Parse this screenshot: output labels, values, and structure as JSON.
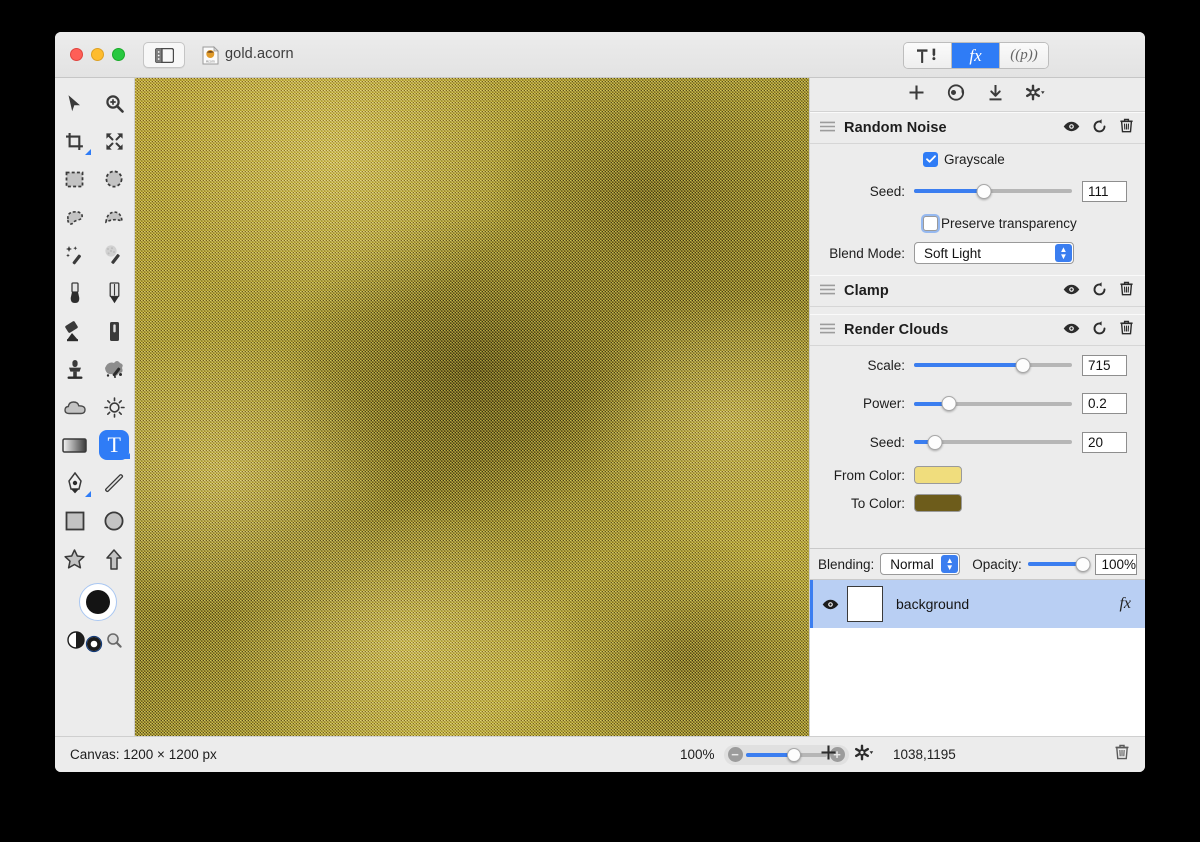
{
  "window": {
    "title": "gold.acorn",
    "doc_icon": "acorn-document-icon",
    "sidebar_toggle_icon": "sidebar-toggle-icon",
    "traffic_lights": [
      "close",
      "minimize",
      "zoom"
    ]
  },
  "segmented": {
    "items": [
      {
        "key": "tools",
        "icon": "hammer-pen-icon",
        "label": "",
        "active": false
      },
      {
        "key": "filters",
        "icon": "fx-icon",
        "label": "fx",
        "active": true
      },
      {
        "key": "presets",
        "icon": "preset-icon",
        "label": "((p))",
        "active": false
      }
    ]
  },
  "tools": {
    "items": [
      {
        "name": "move-tool",
        "icon": "arrow-cursor-icon",
        "selected": false,
        "submenu": false
      },
      {
        "name": "zoom-tool",
        "icon": "magnifier-plus-icon",
        "selected": false,
        "submenu": false
      },
      {
        "name": "crop-tool",
        "icon": "crop-icon",
        "selected": false,
        "submenu": true
      },
      {
        "name": "transform-tool",
        "icon": "four-arrows-icon",
        "selected": false,
        "submenu": false
      },
      {
        "name": "rectangular-select-tool",
        "icon": "marquee-rect-icon",
        "selected": false,
        "submenu": false
      },
      {
        "name": "elliptical-select-tool",
        "icon": "marquee-ellipse-icon",
        "selected": false,
        "submenu": false
      },
      {
        "name": "lasso-tool",
        "icon": "lasso-icon",
        "selected": false,
        "submenu": false
      },
      {
        "name": "polygon-lasso-tool",
        "icon": "polygon-lasso-icon",
        "selected": false,
        "submenu": false
      },
      {
        "name": "magic-wand-tool",
        "icon": "magic-wand-icon",
        "selected": false,
        "submenu": false
      },
      {
        "name": "instant-alpha-tool",
        "icon": "instant-alpha-icon",
        "selected": false,
        "submenu": false
      },
      {
        "name": "brush-tool",
        "icon": "brush-icon",
        "selected": false,
        "submenu": false
      },
      {
        "name": "pencil-tool",
        "icon": "pencil-icon",
        "selected": false,
        "submenu": false
      },
      {
        "name": "paint-bucket-tool",
        "icon": "paint-bucket-icon",
        "selected": false,
        "submenu": false
      },
      {
        "name": "eraser-tool",
        "icon": "eraser-icon",
        "selected": false,
        "submenu": false
      },
      {
        "name": "clone-stamp-tool",
        "icon": "clone-stamp-icon",
        "selected": false,
        "submenu": false
      },
      {
        "name": "smudge-tool",
        "icon": "smudge-splatter-icon",
        "selected": false,
        "submenu": false
      },
      {
        "name": "cloud-tool",
        "icon": "cloud-icon",
        "selected": false,
        "submenu": false
      },
      {
        "name": "dodge-burn-tool",
        "icon": "sun-icon",
        "selected": false,
        "submenu": false
      },
      {
        "name": "gradient-tool",
        "icon": "gradient-icon",
        "selected": false,
        "submenu": false
      },
      {
        "name": "text-tool",
        "icon": "text-T-icon",
        "selected": true,
        "submenu": true
      },
      {
        "name": "bezier-pen-tool",
        "icon": "fountain-pen-icon",
        "selected": false,
        "submenu": true
      },
      {
        "name": "line-tool",
        "icon": "line-icon",
        "selected": false,
        "submenu": false
      },
      {
        "name": "rectangle-shape-tool",
        "icon": "square-shape-icon",
        "selected": false,
        "submenu": false
      },
      {
        "name": "ellipse-shape-tool",
        "icon": "circle-shape-icon",
        "selected": false,
        "submenu": false
      },
      {
        "name": "star-shape-tool",
        "icon": "star-shape-icon",
        "selected": false,
        "submenu": false
      },
      {
        "name": "arrow-shape-tool",
        "icon": "arrow-shape-icon",
        "selected": false,
        "submenu": false
      }
    ],
    "color_well": {
      "name": "foreground-color-well",
      "color": "#141414"
    },
    "mini": [
      {
        "name": "swap-colors-icon"
      },
      {
        "name": "default-colors-icon"
      },
      {
        "name": "magnifier-icon"
      }
    ]
  },
  "inspector": {
    "toolbar": [
      {
        "name": "add-filter-button",
        "icon": "plus-icon"
      },
      {
        "name": "filter-presets-button",
        "icon": "palette-icon"
      },
      {
        "name": "download-filter-button",
        "icon": "download-arrow-icon"
      },
      {
        "name": "filter-options-button",
        "icon": "gear-dropdown-icon"
      }
    ],
    "filters": [
      {
        "name": "Random Noise",
        "actions": [
          "eye-icon",
          "reset-icon",
          "trash-icon"
        ],
        "controls": [
          {
            "type": "checkbox",
            "label": "Grayscale",
            "checked": true
          },
          {
            "type": "slider",
            "label": "Seed:",
            "value": "111",
            "percent": 44
          },
          {
            "type": "checkbox",
            "label": "Preserve transparency",
            "checked": false
          },
          {
            "type": "popup",
            "label": "Blend Mode:",
            "value": "Soft Light"
          }
        ]
      },
      {
        "name": "Clamp",
        "actions": [
          "eye-icon",
          "reset-icon",
          "trash-icon"
        ],
        "controls": []
      },
      {
        "name": "Render Clouds",
        "actions": [
          "eye-icon",
          "reset-icon",
          "trash-icon"
        ],
        "controls": [
          {
            "type": "slider",
            "label": "Scale:",
            "value": "715",
            "percent": 69
          },
          {
            "type": "slider",
            "label": "Power:",
            "value": "0.2",
            "percent": 22
          },
          {
            "type": "slider",
            "label": "Seed:",
            "value": "20",
            "percent": 13
          },
          {
            "type": "color",
            "label": "From Color:",
            "color": "#f0dd7d"
          },
          {
            "type": "color",
            "label": "To Color:",
            "color": "#6d5c1b"
          }
        ]
      }
    ]
  },
  "blending": {
    "label": "Blending:",
    "mode": "Normal",
    "opacity_label": "Opacity:",
    "opacity_value": "100%",
    "opacity_percent": 100
  },
  "layers": [
    {
      "name": "background",
      "visible": true,
      "selected": true,
      "has_effects": true,
      "fx_label": "fx"
    }
  ],
  "status": {
    "canvas_size": "Canvas: 1200 × 1200 px",
    "zoom_percent": "100%",
    "zoom_slider_percent": 50,
    "zoom_out_icon": "minus-circle-icon",
    "zoom_in_icon": "plus-circle-icon",
    "add_layer_icon": "plus-icon",
    "layer_options_icon": "gear-dropdown-icon",
    "coordinates": "1038,1195",
    "delete_layer_icon": "trash-icon"
  },
  "colors": {
    "accent": "#2f7cf6",
    "slider_fill": "#3b7ef0",
    "selection": "#b9cff3",
    "panel_bg": "#ececec"
  }
}
